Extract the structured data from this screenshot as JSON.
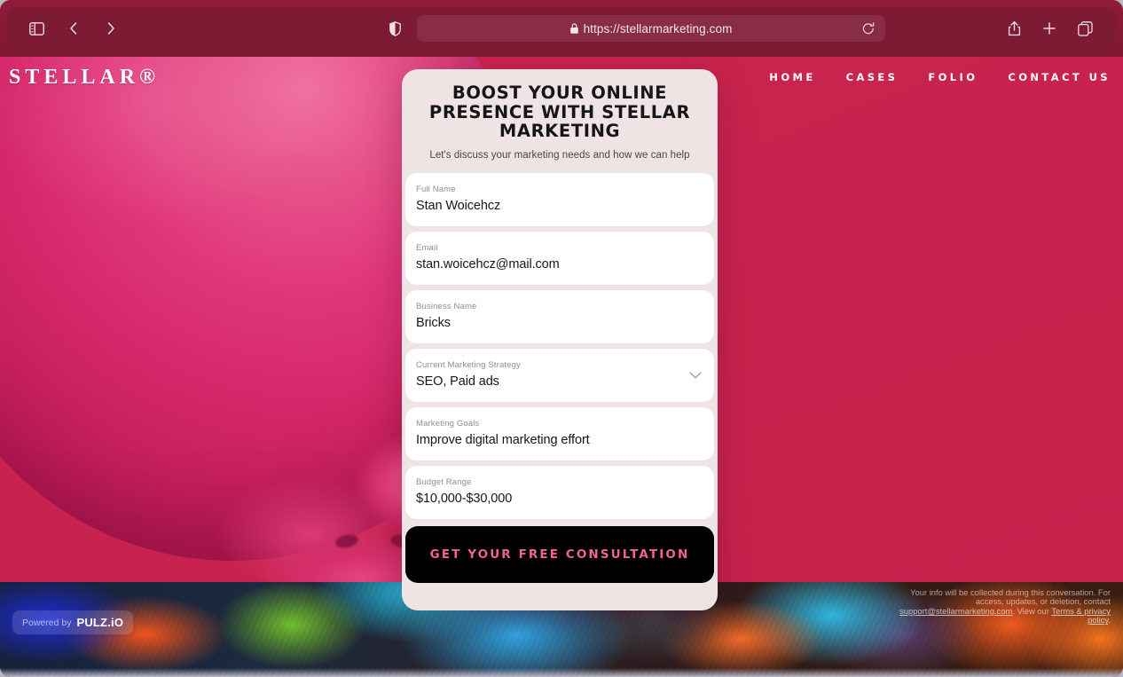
{
  "browser": {
    "url": "https://stellarmarketing.com",
    "icons": {
      "sidebar": "sidebar-toggle-icon",
      "back": "back-arrow-icon",
      "forward": "forward-arrow-icon",
      "shield": "privacy-shield-icon",
      "lock": "lock-icon",
      "reload": "reload-icon",
      "share": "share-icon",
      "new_tab": "plus-icon",
      "tabs": "tab-overview-icon"
    }
  },
  "site": {
    "logo": "STELLAR®",
    "nav": [
      {
        "label": "HOME"
      },
      {
        "label": "CASES"
      },
      {
        "label": "FOLIO"
      },
      {
        "label": "CONTACT US"
      }
    ]
  },
  "form": {
    "title": "BOOST YOUR ONLINE PRESENCE WITH STELLAR MARKETING",
    "subtitle": "Let's discuss your marketing needs and how we can help",
    "fields": [
      {
        "label": "Full Name",
        "value": "Stan Woicehcz",
        "type": "text"
      },
      {
        "label": "Email",
        "value": "stan.woicehcz@mail.com",
        "type": "email"
      },
      {
        "label": "Business Name",
        "value": "Bricks",
        "type": "text"
      },
      {
        "label": "Current Marketing Strategy",
        "value": "SEO, Paid ads",
        "type": "select"
      },
      {
        "label": "Marketing Goals",
        "value": "Improve digital marketing effort",
        "type": "text"
      },
      {
        "label": "Budget Range",
        "value": "$10,000-$30,000",
        "type": "text"
      }
    ],
    "submit_label": "GET YOUR FREE CONSULTATION"
  },
  "powered_by": {
    "prefix": "Powered by",
    "brand": "PULZ.iO"
  },
  "disclaimer": {
    "part1": "Your info will be collected during this conversation. For access, updates, or deletion, contact ",
    "email": "support@stellarmarketing.com",
    "part2": ". View our ",
    "terms": "Terms & privacy policy",
    "part3": "."
  },
  "colors": {
    "brand_pink": "#C8234E",
    "bubble_pink": "#D2256 6",
    "card_bg": "#EFE4E3",
    "button_bg": "#000000",
    "button_text": "#F45FA0",
    "toolbar_bg": "#7D1A34"
  }
}
